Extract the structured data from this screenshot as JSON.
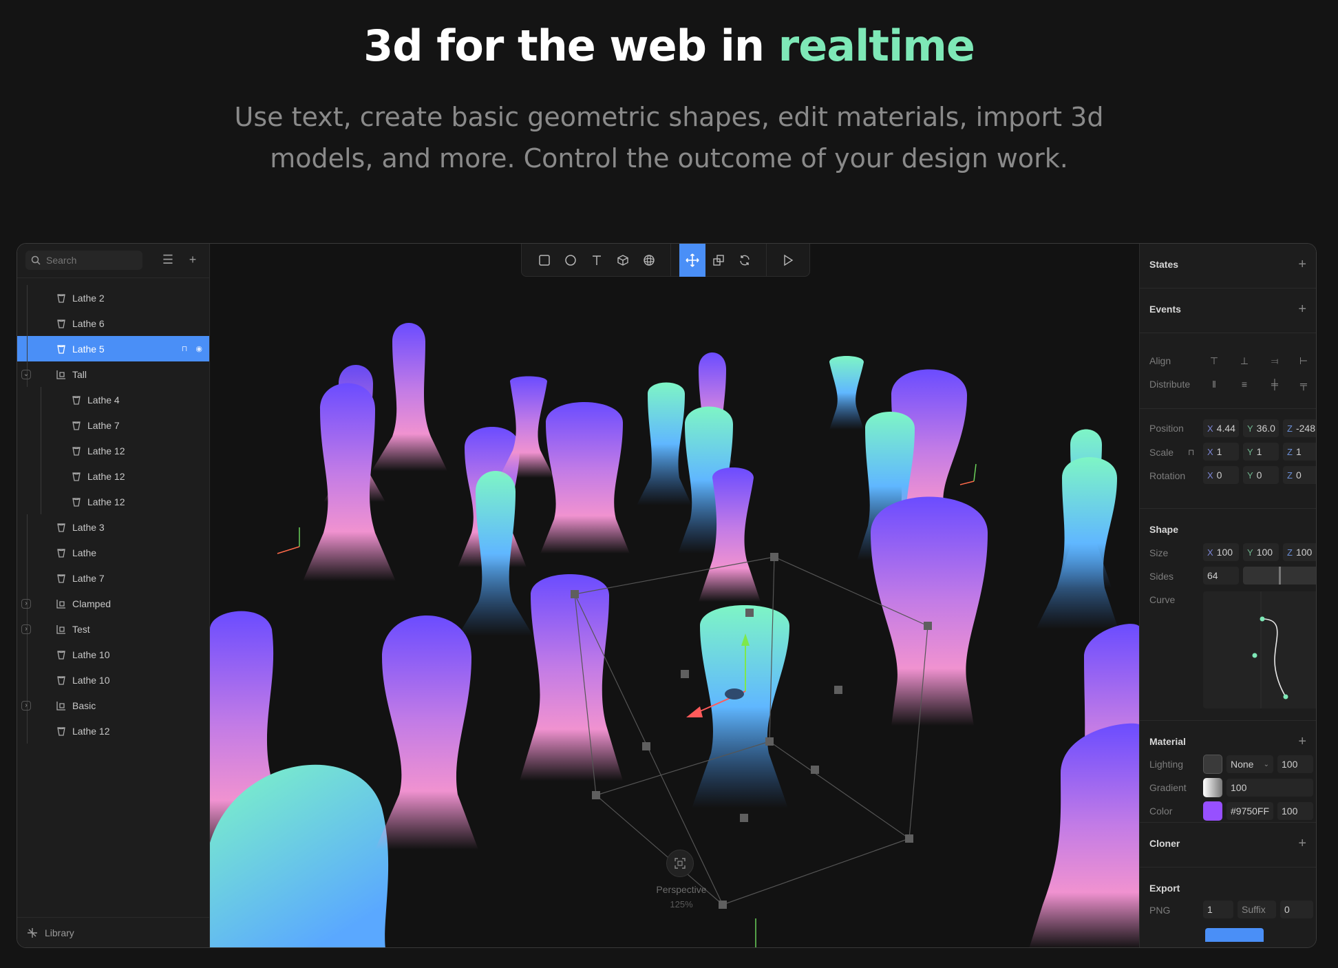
{
  "hero": {
    "title_main": "3d for the web in ",
    "title_accent": "realtime",
    "subtitle": "Use text, create basic geometric shapes, edit materials, import 3d models, and more. Control the outcome of your design work."
  },
  "colors": {
    "accent": "#7ee8b7",
    "selection": "#4a8ff7",
    "material_color": "#9750FF"
  },
  "sidebar": {
    "search_placeholder": "Search",
    "layers": [
      {
        "label": "Lathe 2",
        "depth": 1,
        "type": "lathe"
      },
      {
        "label": "Lathe 6",
        "depth": 1,
        "type": "lathe"
      },
      {
        "label": "Lathe 5",
        "depth": 1,
        "type": "lathe",
        "selected": true
      },
      {
        "label": "Tall",
        "depth": 1,
        "type": "group",
        "expanded": true
      },
      {
        "label": "Lathe 4",
        "depth": 2,
        "type": "lathe"
      },
      {
        "label": "Lathe 7",
        "depth": 2,
        "type": "lathe"
      },
      {
        "label": "Lathe 12",
        "depth": 2,
        "type": "lathe"
      },
      {
        "label": "Lathe 12",
        "depth": 2,
        "type": "lathe"
      },
      {
        "label": "Lathe 12",
        "depth": 2,
        "type": "lathe"
      },
      {
        "label": "Lathe 3",
        "depth": 1,
        "type": "lathe"
      },
      {
        "label": "Lathe",
        "depth": 1,
        "type": "lathe"
      },
      {
        "label": "Lathe 7",
        "depth": 1,
        "type": "lathe"
      },
      {
        "label": "Clamped",
        "depth": 1,
        "type": "group",
        "expanded": false
      },
      {
        "label": "Test",
        "depth": 1,
        "type": "group",
        "expanded": false
      },
      {
        "label": "Lathe 10",
        "depth": 1,
        "type": "lathe"
      },
      {
        "label": "Lathe 10",
        "depth": 1,
        "type": "lathe"
      },
      {
        "label": "Basic",
        "depth": 1,
        "type": "group",
        "expanded": false
      },
      {
        "label": "Lathe 12",
        "depth": 1,
        "type": "lathe"
      }
    ],
    "library_label": "Library"
  },
  "toolbar": {
    "tools": [
      "rectangle-tool",
      "ellipse-tool",
      "text-tool",
      "cube-tool",
      "sphere-tool",
      "move-tool",
      "scale-tool",
      "rotate-tool",
      "play-button"
    ],
    "active": "move-tool"
  },
  "viewport": {
    "camera_label": "Perspective",
    "zoom": "125%"
  },
  "panel": {
    "states": "States",
    "events": "Events",
    "align_label": "Align",
    "distribute_label": "Distribute",
    "position_label": "Position",
    "scale_label": "Scale",
    "rotation_label": "Rotation",
    "position": {
      "x": "4.44",
      "y": "36.0",
      "z": "-248"
    },
    "scale": {
      "x": "1",
      "y": "1",
      "z": "1"
    },
    "rotation": {
      "x": "0",
      "y": "0",
      "z": "0"
    },
    "shape": "Shape",
    "size_label": "Size",
    "size": {
      "x": "100",
      "y": "100",
      "z": "100"
    },
    "sides_label": "Sides",
    "sides": "64",
    "curve_label": "Curve",
    "material": "Material",
    "lighting_label": "Lighting",
    "lighting_value": "None",
    "lighting_opacity": "100",
    "gradient_label": "Gradient",
    "gradient_value": "100",
    "color_label": "Color",
    "color_value": "#9750FF",
    "color_opacity": "100",
    "cloner": "Cloner",
    "export": "Export",
    "export_format": "PNG",
    "export_scale": "1",
    "suffix_label": "Suffix",
    "suffix_value": "0"
  },
  "axis_letters": {
    "x": "X",
    "y": "Y",
    "z": "Z"
  }
}
